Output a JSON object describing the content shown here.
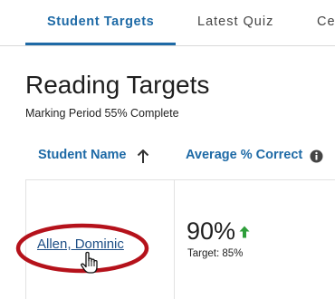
{
  "tabs": [
    {
      "label": "Student Targets",
      "active": true
    },
    {
      "label": "Latest Quiz",
      "active": false
    },
    {
      "label": "Ce",
      "active": false
    }
  ],
  "heading": {
    "title": "Reading Targets",
    "subtitle": "Marking Period 55% Complete",
    "marking_period_complete_percent": 55
  },
  "table": {
    "columns": {
      "name": "Student Name",
      "name_sort": "ascending",
      "average": "Average % Correct"
    },
    "rows": [
      {
        "student_name": "Allen, Dominic",
        "average": "90%",
        "trend": "up",
        "target": "Target: 85%"
      }
    ]
  },
  "icons": {
    "sort": "arrow-up-icon",
    "info": "info-icon",
    "trend": "green-up-arrow-icon",
    "cursor": "hand-pointer-icon"
  },
  "colors": {
    "accent": "#1e6aa6",
    "link": "#1e4f86",
    "highlight": "#b5121b",
    "trend_up": "#2e9e3a"
  }
}
